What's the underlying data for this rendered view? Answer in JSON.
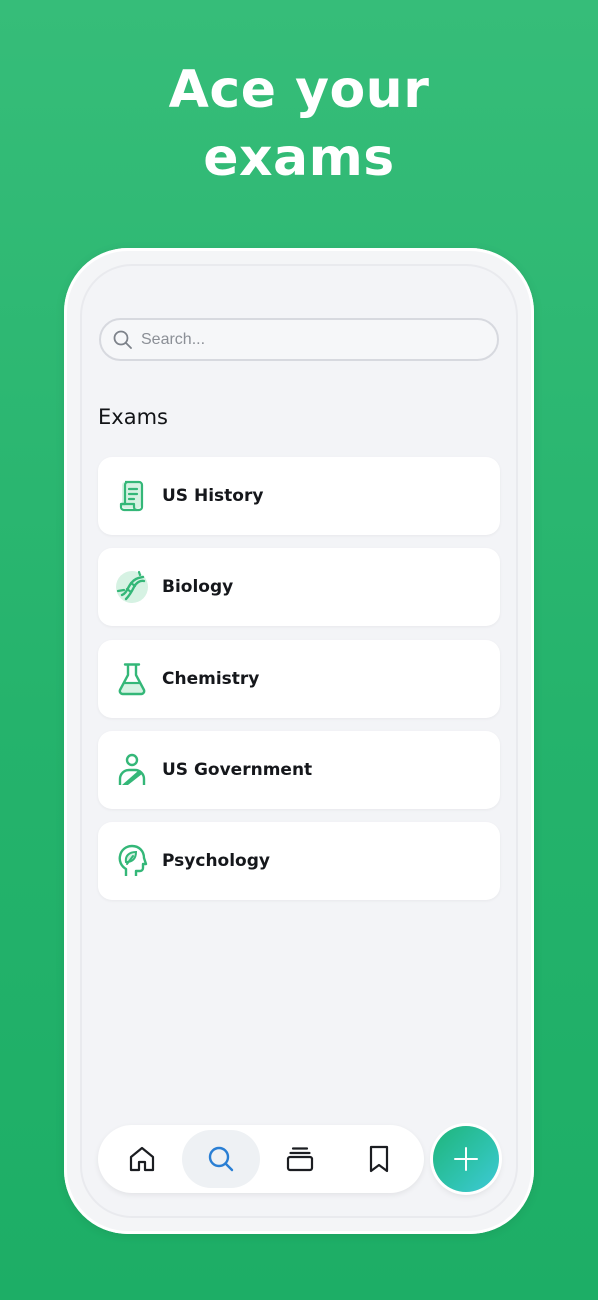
{
  "headline": {
    "line1": "Ace your",
    "line2": "exams"
  },
  "search": {
    "placeholder": "Search...",
    "icon": "search-icon"
  },
  "section_title": "Exams",
  "exams": [
    {
      "label": "US History",
      "icon": "scroll-icon"
    },
    {
      "label": "Biology",
      "icon": "dna-icon"
    },
    {
      "label": "Chemistry",
      "icon": "flask-icon"
    },
    {
      "label": "US Government",
      "icon": "person-sash-icon"
    },
    {
      "label": "Psychology",
      "icon": "head-leaf-icon"
    }
  ],
  "bottom_nav": {
    "items": [
      {
        "name": "home",
        "icon": "home-icon",
        "active": false
      },
      {
        "name": "search",
        "icon": "search-icon",
        "active": true
      },
      {
        "name": "library",
        "icon": "stack-icon",
        "active": false
      },
      {
        "name": "saved",
        "icon": "bookmark-icon",
        "active": false
      }
    ],
    "fab_icon": "plus-icon"
  },
  "colors": {
    "background": "#27b46d",
    "accent": "#2bb673",
    "icon_green": "#34b778",
    "icon_light": "#d6f2e3",
    "nav_active_icon": "#2a7fd4",
    "nav_icon": "#1b1d21",
    "text": "#15171b"
  }
}
